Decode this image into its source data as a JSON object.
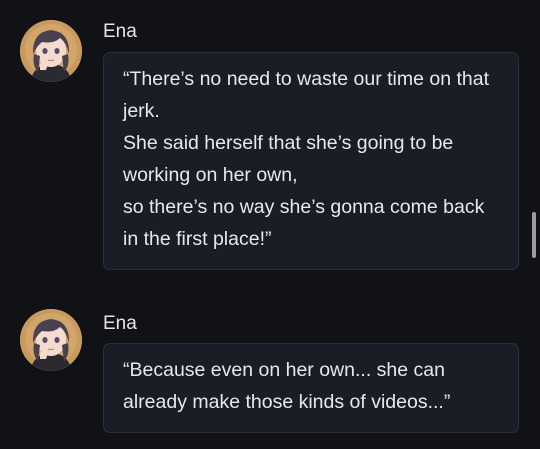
{
  "messages": [
    {
      "speaker": "Ena",
      "lines": [
        "“There’s no need to waste our time on that",
        "jerk.",
        "She said herself that she’s going to be",
        "working on her own,",
        "so there’s no way she’s gonna come back",
        "in the first place!”"
      ]
    },
    {
      "speaker": "Ena",
      "lines": [
        "“Because even on her own... she can",
        "already make those kinds of videos...”"
      ]
    }
  ],
  "colors": {
    "background": "#111216",
    "bubble": "#1b1d26",
    "bubble_border": "#2c2f3b",
    "text": "#e8e8ec",
    "avatar_bg": "#c99a5e"
  }
}
